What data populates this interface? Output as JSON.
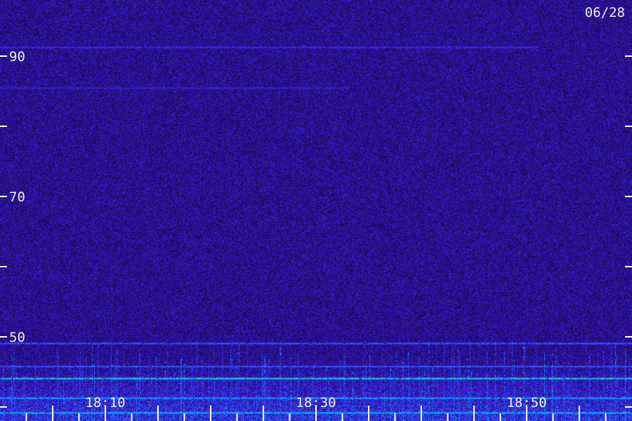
{
  "date_label": "06/28",
  "chart_data": {
    "type": "heatmap",
    "title": "",
    "xlabel": "",
    "ylabel": "",
    "y_axis": {
      "range": [
        38,
        98
      ],
      "major_ticks": [
        50,
        60,
        70,
        80,
        90
      ],
      "labeled_ticks": [
        "50",
        "70",
        "90"
      ]
    },
    "x_axis": {
      "range": [
        "18:00",
        "19:00"
      ],
      "major_ticks": [
        "18:05",
        "18:10",
        "18:15",
        "18:20",
        "18:25",
        "18:30",
        "18:35",
        "18:40",
        "18:45",
        "18:50",
        "18:55"
      ],
      "labeled_ticks": [
        "18:10",
        "18:30",
        "18:50"
      ]
    },
    "colormap": [
      "#1a0a3c",
      "#2a0fa0",
      "#3c28e6",
      "#1e78ff",
      "#00c8ff",
      "#00ff96"
    ],
    "background_intensity": 0.15,
    "lines": [
      {
        "y": 91.3,
        "intensity": 0.45,
        "t_end": 0.85
      },
      {
        "y": 85.5,
        "intensity": 0.35,
        "t_end": 0.55
      },
      {
        "y": 49.1,
        "intensity": 0.6,
        "t_end": 1.0
      },
      {
        "y": 45.8,
        "intensity": 0.6,
        "t_end": 1.0
      },
      {
        "y": 44.1,
        "intensity": 0.95,
        "t_end": 1.0
      },
      {
        "y": 41.3,
        "intensity": 0.8,
        "t_end": 1.0
      },
      {
        "y": 39.2,
        "intensity": 0.85,
        "t_end": 1.0
      }
    ],
    "activity_band": {
      "from": 38,
      "to": 47,
      "intensity": 0.55
    }
  }
}
